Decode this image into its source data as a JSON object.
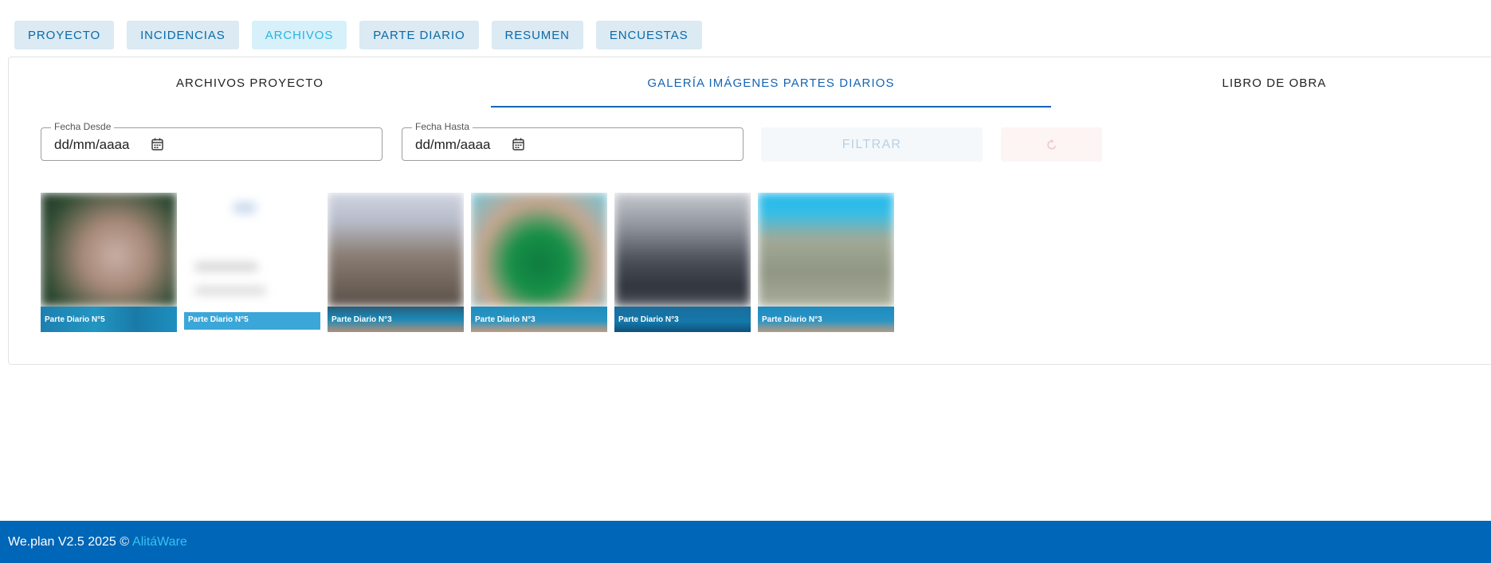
{
  "topnav": {
    "items": [
      {
        "label": "PROYECTO"
      },
      {
        "label": "INCIDENCIAS"
      },
      {
        "label": "ARCHIVOS",
        "active": true
      },
      {
        "label": "PARTE DIARIO"
      },
      {
        "label": "RESUMEN"
      },
      {
        "label": "ENCUESTAS"
      }
    ]
  },
  "tabs": [
    {
      "label": "ARCHIVOS PROYECTO"
    },
    {
      "label": "GALERÍA IMÁGENES PARTES DIARIOS",
      "active": true
    },
    {
      "label": "LIBRO DE OBRA"
    }
  ],
  "filters": {
    "from": {
      "label": "Fecha Desde",
      "value": "dd/mm/aaaa"
    },
    "to": {
      "label": "Fecha Hasta",
      "value": "dd/mm/aaaa"
    },
    "filter_label": "FILTRAR",
    "reset_icon": "refresh-icon"
  },
  "gallery": [
    {
      "caption": "Parte Diario N°5"
    },
    {
      "caption": "Parte Diario N°5"
    },
    {
      "caption": "Parte Diario N°3"
    },
    {
      "caption": "Parte Diario N°3"
    },
    {
      "caption": "Parte Diario N°3"
    },
    {
      "caption": "Parte Diario N°3"
    }
  ],
  "footer": {
    "text": "We.plan V2.5 2025 ©",
    "brand": "AlitáWare"
  },
  "colors": {
    "accent": "#1565b4",
    "footer_bg": "#0066b8",
    "brand": "#35c4f0"
  }
}
